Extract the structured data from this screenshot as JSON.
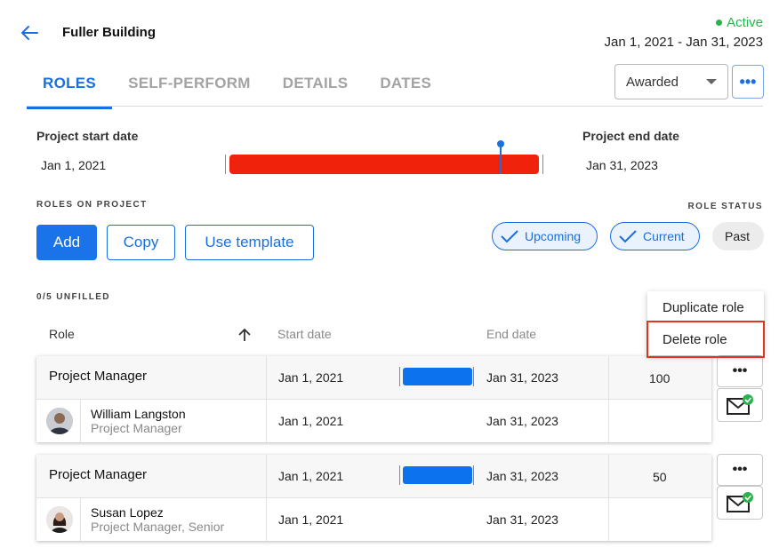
{
  "header": {
    "title": "Fuller Building",
    "status": "Active",
    "date_range": "Jan 1, 2021 - Jan 31, 2023",
    "colors": {
      "accent": "#1a6fe0",
      "active": "#2bb24c",
      "timeline_bar": "#f0220c"
    }
  },
  "tabs": [
    "ROLES",
    "SELF-PERFORM",
    "DETAILS",
    "DATES"
  ],
  "active_tab": "ROLES",
  "stage_select": {
    "value": "Awarded"
  },
  "project": {
    "start_label": "Project start date",
    "start_value": "Jan 1, 2021",
    "end_label": "Project end date",
    "end_value": "Jan 31, 2023"
  },
  "roles_section": {
    "heading": "ROLES ON PROJECT",
    "add_label": "Add",
    "copy_label": "Copy",
    "template_label": "Use template",
    "status_heading": "ROLE STATUS",
    "chips": [
      {
        "label": "Upcoming",
        "checked": true
      },
      {
        "label": "Current",
        "checked": true
      },
      {
        "label": "Past",
        "checked": false
      }
    ],
    "unfilled": "0/5 UNFILLED"
  },
  "table": {
    "headers": {
      "role": "Role",
      "start": "Start date",
      "end": "End date"
    },
    "rows": [
      {
        "role": "Project Manager",
        "start": "Jan 1, 2021",
        "end": "Jan 31, 2023",
        "allocation": "100",
        "person": {
          "name": "William Langston",
          "title": "Project Manager",
          "start": "Jan 1, 2021",
          "end": "Jan 31, 2023"
        }
      },
      {
        "role": "Project Manager",
        "start": "Jan 1, 2021",
        "end": "Jan 31, 2023",
        "allocation": "50",
        "person": {
          "name": "Susan Lopez",
          "title": "Project Manager, Senior",
          "start": "Jan 1, 2021",
          "end": "Jan 31, 2023"
        }
      }
    ]
  },
  "menu": {
    "items": [
      "Duplicate role",
      "Delete role"
    ],
    "highlighted": "Delete role"
  },
  "more_label": "•••"
}
